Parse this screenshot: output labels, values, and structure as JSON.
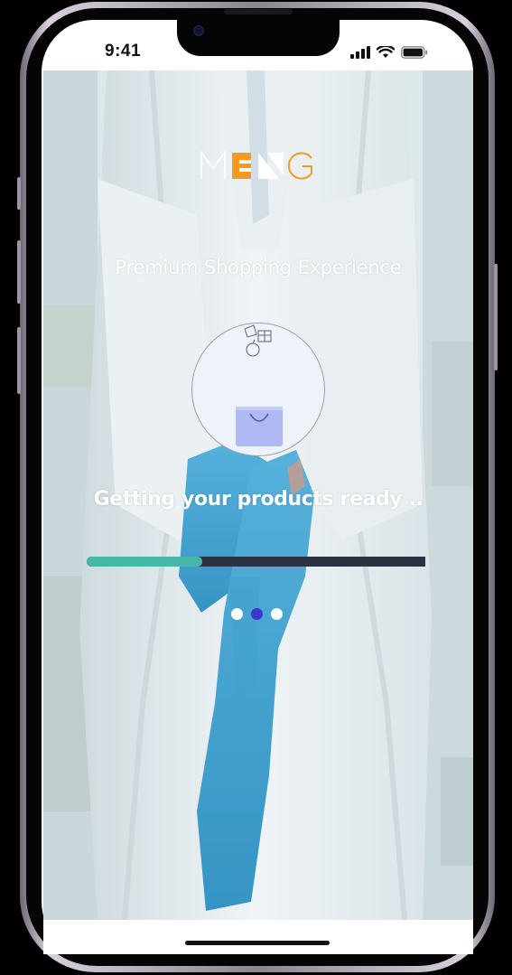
{
  "status_bar": {
    "time": "9:41",
    "icons": [
      "cellular-signal-icon",
      "wifi-icon",
      "battery-icon"
    ]
  },
  "brand": {
    "logo_text": "MENG",
    "colors": {
      "accent_orange": "#f39a24",
      "letter_white": "#ffffff"
    }
  },
  "splash": {
    "tagline": "Premium Shopping Experience",
    "loading_text": "Getting your products ready ..",
    "illustration_icons": [
      "gift-icon",
      "apple-icon",
      "shopping-bag-icon"
    ],
    "progress": {
      "value": 0.34,
      "track_color": "#2b3340",
      "fill_color": "#47b8a8"
    },
    "pager": {
      "count": 3,
      "active_index": 1,
      "active_color": "#3c36c9",
      "inactive_color": "#ffffff"
    }
  }
}
